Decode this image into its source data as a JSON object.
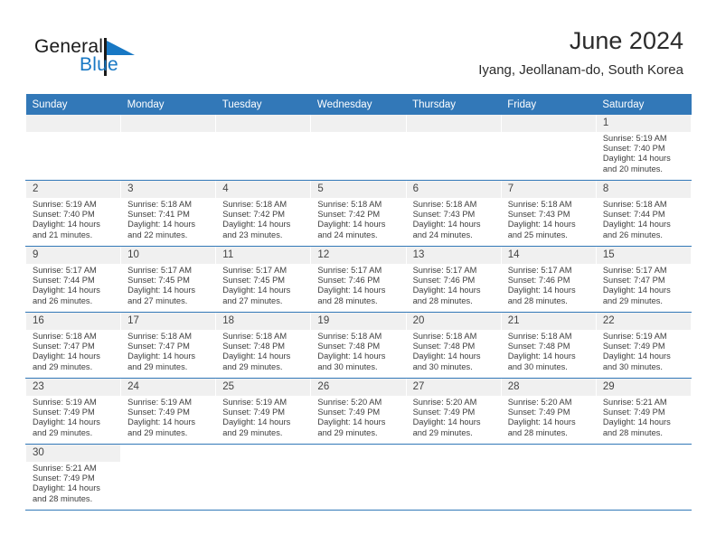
{
  "brand": {
    "name_part1": "General",
    "name_part2": "Blue",
    "mark": "triangle-flag-icon",
    "accent_color": "#1878c4"
  },
  "header": {
    "title": "June 2024",
    "subtitle": "Iyang, Jeollanam-do, South Korea"
  },
  "theme": {
    "header_blue": "#3278b8",
    "daynum_band": "#f0f0f0",
    "text": "#3d3d3d"
  },
  "weekdays": [
    "Sunday",
    "Monday",
    "Tuesday",
    "Wednesday",
    "Thursday",
    "Friday",
    "Saturday"
  ],
  "labels": {
    "sunrise": "Sunrise:",
    "sunset": "Sunset:",
    "daylight": "Daylight:"
  },
  "weeks": [
    [
      {
        "day": "",
        "blank": true
      },
      {
        "day": "",
        "blank": true
      },
      {
        "day": "",
        "blank": true
      },
      {
        "day": "",
        "blank": true
      },
      {
        "day": "",
        "blank": true
      },
      {
        "day": "",
        "blank": true
      },
      {
        "day": "1",
        "sunrise": "Sunrise: 5:19 AM",
        "sunset": "Sunset: 7:40 PM",
        "daylight1": "Daylight: 14 hours",
        "daylight2": "and 20 minutes."
      }
    ],
    [
      {
        "day": "2",
        "sunrise": "Sunrise: 5:19 AM",
        "sunset": "Sunset: 7:40 PM",
        "daylight1": "Daylight: 14 hours",
        "daylight2": "and 21 minutes."
      },
      {
        "day": "3",
        "sunrise": "Sunrise: 5:18 AM",
        "sunset": "Sunset: 7:41 PM",
        "daylight1": "Daylight: 14 hours",
        "daylight2": "and 22 minutes."
      },
      {
        "day": "4",
        "sunrise": "Sunrise: 5:18 AM",
        "sunset": "Sunset: 7:42 PM",
        "daylight1": "Daylight: 14 hours",
        "daylight2": "and 23 minutes."
      },
      {
        "day": "5",
        "sunrise": "Sunrise: 5:18 AM",
        "sunset": "Sunset: 7:42 PM",
        "daylight1": "Daylight: 14 hours",
        "daylight2": "and 24 minutes."
      },
      {
        "day": "6",
        "sunrise": "Sunrise: 5:18 AM",
        "sunset": "Sunset: 7:43 PM",
        "daylight1": "Daylight: 14 hours",
        "daylight2": "and 24 minutes."
      },
      {
        "day": "7",
        "sunrise": "Sunrise: 5:18 AM",
        "sunset": "Sunset: 7:43 PM",
        "daylight1": "Daylight: 14 hours",
        "daylight2": "and 25 minutes."
      },
      {
        "day": "8",
        "sunrise": "Sunrise: 5:18 AM",
        "sunset": "Sunset: 7:44 PM",
        "daylight1": "Daylight: 14 hours",
        "daylight2": "and 26 minutes."
      }
    ],
    [
      {
        "day": "9",
        "sunrise": "Sunrise: 5:17 AM",
        "sunset": "Sunset: 7:44 PM",
        "daylight1": "Daylight: 14 hours",
        "daylight2": "and 26 minutes."
      },
      {
        "day": "10",
        "sunrise": "Sunrise: 5:17 AM",
        "sunset": "Sunset: 7:45 PM",
        "daylight1": "Daylight: 14 hours",
        "daylight2": "and 27 minutes."
      },
      {
        "day": "11",
        "sunrise": "Sunrise: 5:17 AM",
        "sunset": "Sunset: 7:45 PM",
        "daylight1": "Daylight: 14 hours",
        "daylight2": "and 27 minutes."
      },
      {
        "day": "12",
        "sunrise": "Sunrise: 5:17 AM",
        "sunset": "Sunset: 7:46 PM",
        "daylight1": "Daylight: 14 hours",
        "daylight2": "and 28 minutes."
      },
      {
        "day": "13",
        "sunrise": "Sunrise: 5:17 AM",
        "sunset": "Sunset: 7:46 PM",
        "daylight1": "Daylight: 14 hours",
        "daylight2": "and 28 minutes."
      },
      {
        "day": "14",
        "sunrise": "Sunrise: 5:17 AM",
        "sunset": "Sunset: 7:46 PM",
        "daylight1": "Daylight: 14 hours",
        "daylight2": "and 28 minutes."
      },
      {
        "day": "15",
        "sunrise": "Sunrise: 5:17 AM",
        "sunset": "Sunset: 7:47 PM",
        "daylight1": "Daylight: 14 hours",
        "daylight2": "and 29 minutes."
      }
    ],
    [
      {
        "day": "16",
        "sunrise": "Sunrise: 5:18 AM",
        "sunset": "Sunset: 7:47 PM",
        "daylight1": "Daylight: 14 hours",
        "daylight2": "and 29 minutes."
      },
      {
        "day": "17",
        "sunrise": "Sunrise: 5:18 AM",
        "sunset": "Sunset: 7:47 PM",
        "daylight1": "Daylight: 14 hours",
        "daylight2": "and 29 minutes."
      },
      {
        "day": "18",
        "sunrise": "Sunrise: 5:18 AM",
        "sunset": "Sunset: 7:48 PM",
        "daylight1": "Daylight: 14 hours",
        "daylight2": "and 29 minutes."
      },
      {
        "day": "19",
        "sunrise": "Sunrise: 5:18 AM",
        "sunset": "Sunset: 7:48 PM",
        "daylight1": "Daylight: 14 hours",
        "daylight2": "and 30 minutes."
      },
      {
        "day": "20",
        "sunrise": "Sunrise: 5:18 AM",
        "sunset": "Sunset: 7:48 PM",
        "daylight1": "Daylight: 14 hours",
        "daylight2": "and 30 minutes."
      },
      {
        "day": "21",
        "sunrise": "Sunrise: 5:18 AM",
        "sunset": "Sunset: 7:48 PM",
        "daylight1": "Daylight: 14 hours",
        "daylight2": "and 30 minutes."
      },
      {
        "day": "22",
        "sunrise": "Sunrise: 5:19 AM",
        "sunset": "Sunset: 7:49 PM",
        "daylight1": "Daylight: 14 hours",
        "daylight2": "and 30 minutes."
      }
    ],
    [
      {
        "day": "23",
        "sunrise": "Sunrise: 5:19 AM",
        "sunset": "Sunset: 7:49 PM",
        "daylight1": "Daylight: 14 hours",
        "daylight2": "and 29 minutes."
      },
      {
        "day": "24",
        "sunrise": "Sunrise: 5:19 AM",
        "sunset": "Sunset: 7:49 PM",
        "daylight1": "Daylight: 14 hours",
        "daylight2": "and 29 minutes."
      },
      {
        "day": "25",
        "sunrise": "Sunrise: 5:19 AM",
        "sunset": "Sunset: 7:49 PM",
        "daylight1": "Daylight: 14 hours",
        "daylight2": "and 29 minutes."
      },
      {
        "day": "26",
        "sunrise": "Sunrise: 5:20 AM",
        "sunset": "Sunset: 7:49 PM",
        "daylight1": "Daylight: 14 hours",
        "daylight2": "and 29 minutes."
      },
      {
        "day": "27",
        "sunrise": "Sunrise: 5:20 AM",
        "sunset": "Sunset: 7:49 PM",
        "daylight1": "Daylight: 14 hours",
        "daylight2": "and 29 minutes."
      },
      {
        "day": "28",
        "sunrise": "Sunrise: 5:20 AM",
        "sunset": "Sunset: 7:49 PM",
        "daylight1": "Daylight: 14 hours",
        "daylight2": "and 28 minutes."
      },
      {
        "day": "29",
        "sunrise": "Sunrise: 5:21 AM",
        "sunset": "Sunset: 7:49 PM",
        "daylight1": "Daylight: 14 hours",
        "daylight2": "and 28 minutes."
      }
    ],
    [
      {
        "day": "30",
        "sunrise": "Sunrise: 5:21 AM",
        "sunset": "Sunset: 7:49 PM",
        "daylight1": "Daylight: 14 hours",
        "daylight2": "and 28 minutes."
      },
      {
        "day": "",
        "blank": true
      },
      {
        "day": "",
        "blank": true
      },
      {
        "day": "",
        "blank": true
      },
      {
        "day": "",
        "blank": true
      },
      {
        "day": "",
        "blank": true
      },
      {
        "day": "",
        "blank": true
      }
    ]
  ]
}
